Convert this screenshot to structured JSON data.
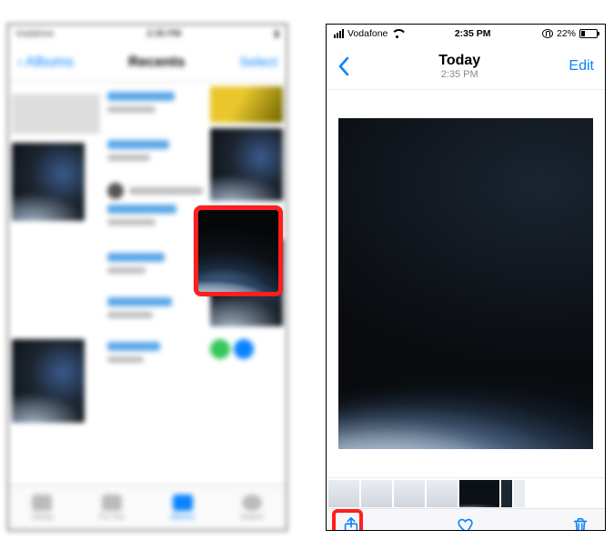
{
  "colors": {
    "accent": "#0a84ff",
    "highlight": "#ff1e1e"
  },
  "left": {
    "status": {
      "carrier": "Vodafone",
      "time": "2:35 PM"
    },
    "nav": {
      "back": "Albums",
      "title": "Recents",
      "action": "Select"
    },
    "tabs": [
      "Library",
      "For You",
      "Albums",
      "Search"
    ]
  },
  "right": {
    "status": {
      "carrier": "Vodafone",
      "time": "2:35 PM",
      "battery_pct": "22%"
    },
    "nav": {
      "title": "Today",
      "subtitle": "2:35 PM",
      "edit": "Edit"
    },
    "toolbar": {
      "share_icon": "share-icon",
      "heart_icon": "heart-icon",
      "trash_icon": "trash-icon"
    }
  }
}
